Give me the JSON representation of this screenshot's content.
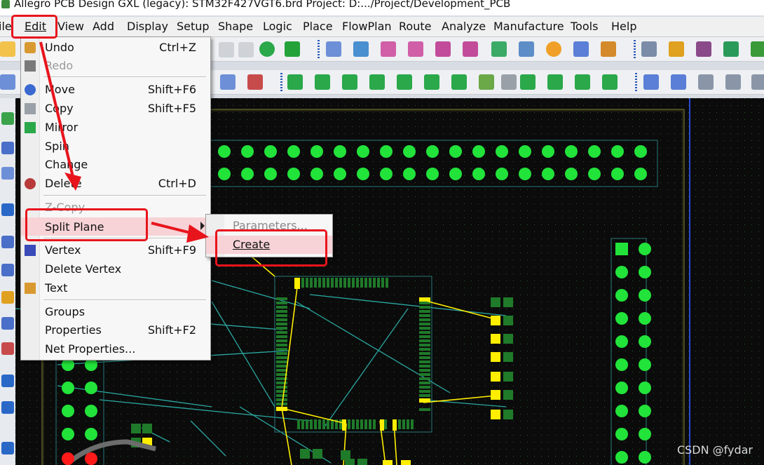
{
  "window": {
    "title": "Allegro PCB Design GXL (legacy): STM32F427VGT6.brd  Project: D:.../Project/Development_PCB"
  },
  "menubar": {
    "items": [
      "ile",
      "Edit",
      "View",
      "Add",
      "Display",
      "Setup",
      "Shape",
      "Logic",
      "Place",
      "FlowPlan",
      "Route",
      "Analyze",
      "Manufacture",
      "Tools",
      "Help"
    ]
  },
  "edit_menu": {
    "items": [
      {
        "label": "Undo",
        "shortcut": "Ctrl+Z",
        "disabled": false
      },
      {
        "label": "Redo",
        "shortcut": "",
        "disabled": true
      },
      {
        "label": "Move",
        "shortcut": "Shift+F6",
        "disabled": false
      },
      {
        "label": "Copy",
        "shortcut": "Shift+F5",
        "disabled": false
      },
      {
        "label": "Mirror",
        "shortcut": "",
        "disabled": false
      },
      {
        "label": "Spin",
        "shortcut": "",
        "disabled": false
      },
      {
        "label": "Change",
        "shortcut": "",
        "disabled": false
      },
      {
        "label": "Delete",
        "shortcut": "Ctrl+D",
        "disabled": false
      },
      {
        "label": "Z-Copy",
        "shortcut": "",
        "disabled": true
      },
      {
        "label": "Split Plane",
        "shortcut": "",
        "disabled": false
      },
      {
        "label": "Vertex",
        "shortcut": "Shift+F9",
        "disabled": false
      },
      {
        "label": "Delete Vertex",
        "shortcut": "",
        "disabled": false
      },
      {
        "label": "Text",
        "shortcut": "",
        "disabled": false
      },
      {
        "label": "Groups",
        "shortcut": "",
        "disabled": false
      },
      {
        "label": "Properties",
        "shortcut": "Shift+F2",
        "disabled": false
      },
      {
        "label": "Net Properties...",
        "shortcut": "",
        "disabled": false
      }
    ]
  },
  "split_plane_submenu": {
    "items": [
      {
        "label": "Parameters...",
        "disabled": true
      },
      {
        "label": "Create",
        "disabled": false
      }
    ]
  },
  "watermark": "CSDN @fydar",
  "colors": {
    "pad": "#22e33a",
    "trace_yellow": "#ffee00",
    "ratsnest": "#2aa7a0",
    "highlight_box": "#e8141c",
    "canvas": "#0b0b0b"
  }
}
